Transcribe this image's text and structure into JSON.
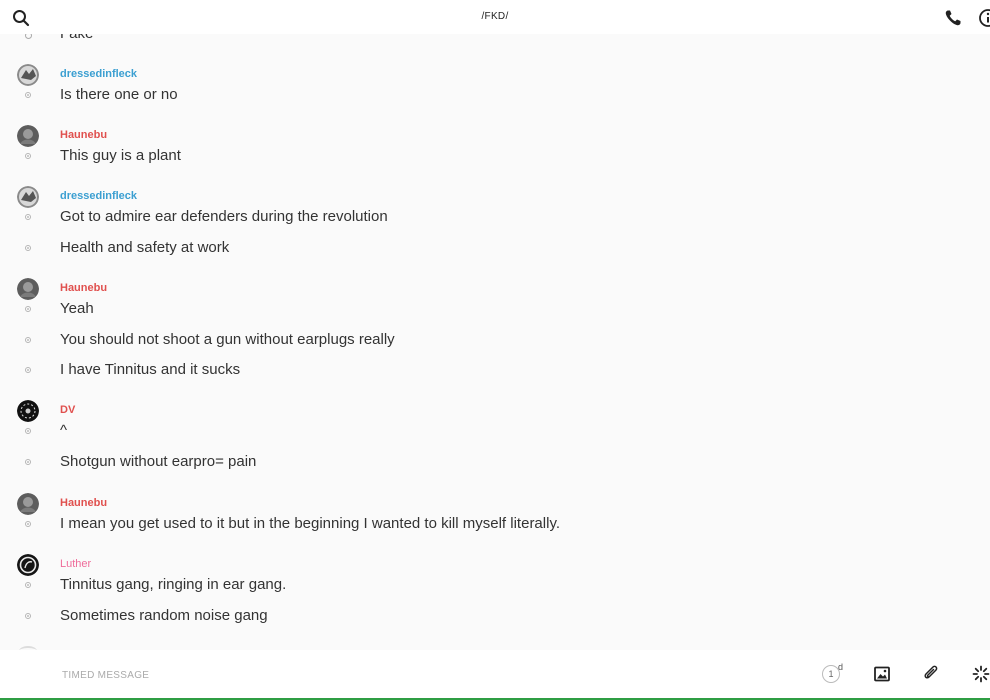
{
  "header": {
    "title": "/FKD/",
    "left_icon": "search-icon",
    "right_icons": [
      "phone-icon",
      "info-icon"
    ]
  },
  "colors": {
    "dressedinfleck": "#3b9fd1",
    "Haunebu": "#e0504e",
    "DV": "#e0504e",
    "Luther": "#ef6c9a",
    "bottom_accent": "#2f9e44"
  },
  "messages": {
    "cutoff_text": "Fake",
    "groups": [
      {
        "sender": "dressedinfleck",
        "texts": [
          "Is there one or no"
        ]
      },
      {
        "sender": "Haunebu",
        "texts": [
          "This guy is a plant"
        ]
      },
      {
        "sender": "dressedinfleck",
        "texts": [
          "Got to admire ear defenders during the revolution",
          "Health and safety at work"
        ]
      },
      {
        "sender": "Haunebu",
        "texts": [
          "Yeah",
          "You should not shoot a gun without earplugs really",
          "I have Tinnitus and it sucks"
        ]
      },
      {
        "sender": "DV",
        "texts": [
          "^",
          "Shotgun without earpro= pain"
        ]
      },
      {
        "sender": "Haunebu",
        "texts": [
          "I mean you get used to it but in the beginning I wanted to kill myself literally."
        ]
      },
      {
        "sender": "Luther",
        "texts": [
          "Tinnitus gang, ringing in ear gang.",
          "Sometimes random noise gang"
        ]
      }
    ]
  },
  "composer": {
    "placeholder": "TIMED MESSAGE",
    "timer_value": "1",
    "timer_unit": "d",
    "icons": [
      "timer-icon",
      "image-icon",
      "paperclip-icon",
      "gif-icon"
    ]
  }
}
